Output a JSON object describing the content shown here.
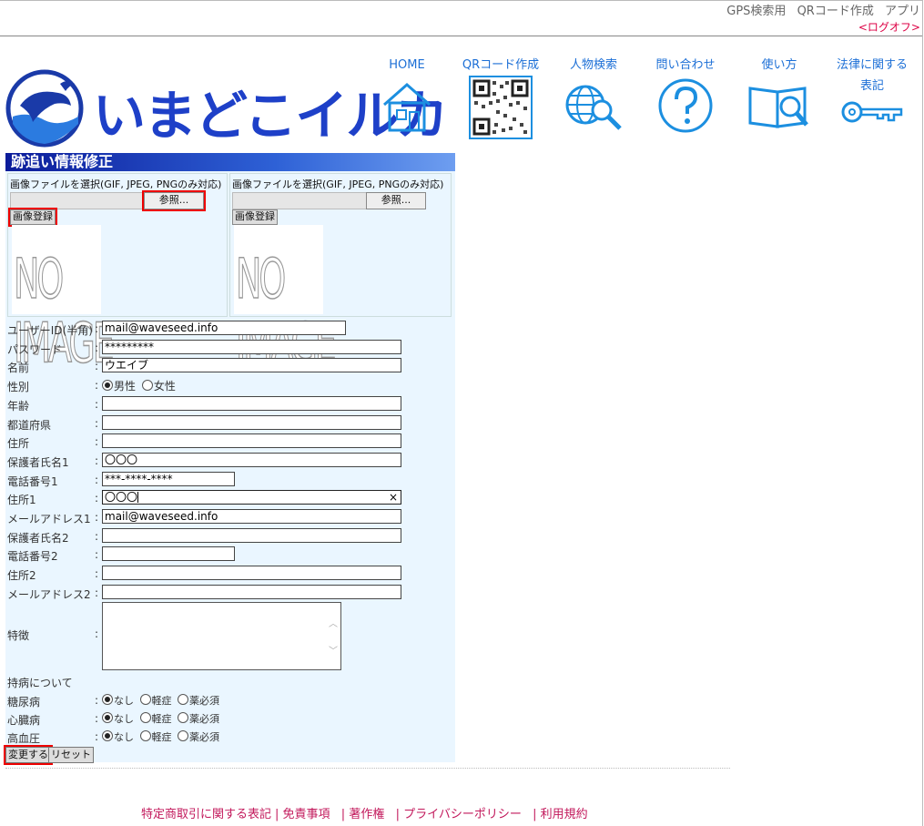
{
  "header": {
    "top_links": [
      "GPS検索用",
      "QRコード作成",
      "アプリ"
    ],
    "logoff": "<ログオフ>",
    "logo_text": "いまどこイルカ"
  },
  "nav": [
    {
      "label": "HOME",
      "icon": "home-icon"
    },
    {
      "label": "QRコード作成",
      "icon": "qr-code-icon"
    },
    {
      "label": "人物検索",
      "icon": "globe-search-icon"
    },
    {
      "label": "問い合わせ",
      "icon": "question-icon"
    },
    {
      "label": "使い方",
      "icon": "book-search-icon"
    },
    {
      "label": "法律に関する",
      "label2": "表記",
      "icon": "key-icon"
    }
  ],
  "form": {
    "title": "跡追い情報修正",
    "image_caption": "画像ファイルを選択(GIF, JPEG, PNGのみ対応)",
    "browse_label": "参照...",
    "register_label": "画像登録",
    "no_image": "NO IMAGE",
    "fields": [
      {
        "label": "ユーザーID(半角)",
        "value": "mail@waveseed.info"
      },
      {
        "label": "パスワード",
        "value": "*********"
      },
      {
        "label": "名前",
        "value": "ウエイブ"
      },
      {
        "label": "性別",
        "options": [
          "男性",
          "女性"
        ],
        "selected": 0
      },
      {
        "label": "年齢",
        "value": ""
      },
      {
        "label": "都道府県",
        "value": ""
      },
      {
        "label": "住所",
        "value": ""
      },
      {
        "label": "保護者氏名1",
        "value": "〇〇〇"
      },
      {
        "label": "電話番号1",
        "value": "***-****-****"
      },
      {
        "label": "住所1",
        "value": "〇〇〇"
      },
      {
        "label": "メールアドレス1",
        "value": "mail@waveseed.info"
      },
      {
        "label": "保護者氏名2",
        "value": ""
      },
      {
        "label": "電話番号2",
        "value": ""
      },
      {
        "label": "住所2",
        "value": ""
      },
      {
        "label": "メールアドレス2",
        "value": ""
      },
      {
        "label": "特徴",
        "value": ""
      }
    ],
    "colon": ":",
    "illness_heading": "持病について",
    "illness": [
      {
        "label": "糖尿病",
        "options": [
          "なし",
          "軽症",
          "薬必須"
        ],
        "selected": 0
      },
      {
        "label": "心臓病",
        "options": [
          "なし",
          "軽症",
          "薬必須"
        ],
        "selected": 0
      },
      {
        "label": "高血圧",
        "options": [
          "なし",
          "軽症",
          "薬必須"
        ],
        "selected": 0
      }
    ],
    "submit_label": "変更する",
    "reset_label": "リセット",
    "clear_icon": "×"
  },
  "footer": {
    "links": [
      "特定商取引に関する表記",
      "免責事項",
      "著作権",
      "プライバシーポリシー",
      "利用規約"
    ]
  },
  "colors": {
    "accent": "#1e40c8",
    "nav": "#1c6fd6",
    "footer": "#c2185b",
    "panel": "#eaf6ff",
    "highlight": "#e00000"
  }
}
